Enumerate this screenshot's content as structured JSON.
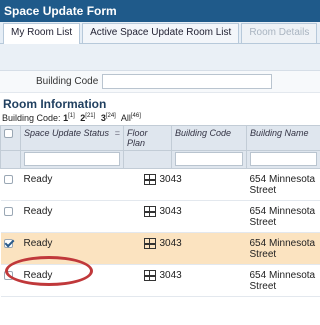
{
  "form": {
    "title": "Space Update Form"
  },
  "tabs": [
    {
      "label": "My Room List",
      "state": "active"
    },
    {
      "label": "Active Space Update Room List",
      "state": "normal"
    },
    {
      "label": "Room Details",
      "state": "disabled"
    }
  ],
  "building_filter": {
    "label": "Building Code",
    "value": ""
  },
  "section": {
    "title": "Room Information"
  },
  "code_filter": {
    "label": "Building Code:",
    "items": [
      {
        "code": "1",
        "count": "[1]"
      },
      {
        "code": "2",
        "count": "[21]"
      },
      {
        "code": "3",
        "count": "[24]"
      },
      {
        "code": "All",
        "count": "[46]"
      }
    ]
  },
  "table": {
    "columns": [
      "Space Update Status",
      "Floor Plan",
      "Building Code",
      "Building Name"
    ],
    "sort_mark": "=",
    "rows": [
      {
        "checked": false,
        "status": "Ready",
        "building_code": "3043",
        "building_name": "654 Minnesota Street",
        "selected": false
      },
      {
        "checked": false,
        "status": "Ready",
        "building_code": "3043",
        "building_name": "654 Minnesota Street",
        "selected": false
      },
      {
        "checked": true,
        "status": "Ready",
        "building_code": "3043",
        "building_name": "654 Minnesota Street",
        "selected": true
      },
      {
        "checked": false,
        "status": "Ready",
        "building_code": "3043",
        "building_name": "654 Minnesota Street",
        "selected": false
      }
    ]
  },
  "colors": {
    "header": "#1f5a8a",
    "selected_row": "#fbe3c0",
    "highlight_ring": "#c0383a"
  },
  "icons": {
    "floor_plan": "floor-plan-icon",
    "checkbox": "checkbox"
  }
}
